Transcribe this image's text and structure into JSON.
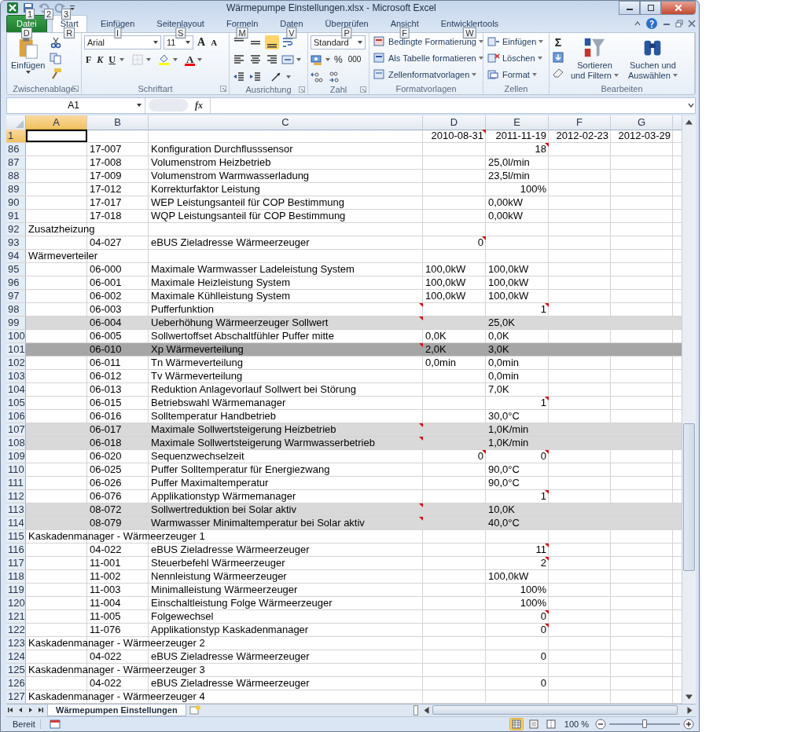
{
  "window": {
    "title": "Wärmepumpe Einstellungen.xlsx - Microsoft Excel"
  },
  "quick_access": {
    "keytips": [
      "1",
      "2",
      "3"
    ]
  },
  "tabs": [
    {
      "label": "Datei",
      "kind": "file",
      "selected": false,
      "keytip": "D"
    },
    {
      "label": "Start",
      "kind": "tab",
      "selected": true,
      "keytip": "R"
    },
    {
      "label": "Einfügen",
      "kind": "tab",
      "selected": false,
      "keytip": "I"
    },
    {
      "label": "Seitenlayout",
      "kind": "tab",
      "selected": false,
      "keytip": "S"
    },
    {
      "label": "Formeln",
      "kind": "tab",
      "selected": false,
      "keytip": "M"
    },
    {
      "label": "Daten",
      "kind": "tab",
      "selected": false,
      "keytip": "V"
    },
    {
      "label": "Überprüfen",
      "kind": "tab",
      "selected": false,
      "keytip": "P"
    },
    {
      "label": "Ansicht",
      "kind": "tab",
      "selected": false,
      "keytip": "F"
    },
    {
      "label": "Entwicklertools",
      "kind": "tab",
      "selected": false,
      "keytip": "W"
    }
  ],
  "ribbon": {
    "groups": [
      {
        "label": "Zwischenablage",
        "launcher": true,
        "paste": "Einfügen"
      },
      {
        "label": "Schriftart",
        "launcher": true,
        "font": "Arial",
        "size": "11",
        "grow": "A",
        "shrink": "A",
        "bold": "F",
        "italic": "K",
        "underline": "U",
        "color_letter": "A"
      },
      {
        "label": "Ausrichtung",
        "launcher": true,
        "vertical_align": [
          {
            "selected": false
          },
          {
            "selected": false
          },
          {
            "selected": true
          }
        ]
      },
      {
        "label": "Zahl",
        "launcher": true,
        "format": "Standard",
        "percent": "%",
        "thousands": "000"
      },
      {
        "label": "Formatvorlagen",
        "launcher": false,
        "items": [
          "Bedingte Formatierung",
          "Als Tabelle formatieren",
          "Zellenformatvorlagen"
        ]
      },
      {
        "label": "Zellen",
        "launcher": false,
        "items": [
          "Einfügen",
          "Löschen",
          "Format"
        ]
      },
      {
        "label": "Bearbeiten",
        "launcher": false,
        "sum": "Σ",
        "sort": [
          "Sortieren",
          "und Filtern"
        ],
        "find": [
          "Suchen und",
          "Auswählen"
        ]
      }
    ]
  },
  "formula_bar": {
    "name_box": "A1",
    "fx": "fx"
  },
  "sheet": {
    "columns": [
      {
        "label": "A",
        "selected": true
      },
      {
        "label": "B",
        "selected": false
      },
      {
        "label": "C",
        "selected": false
      },
      {
        "label": "D",
        "selected": false
      },
      {
        "label": "E",
        "selected": false
      },
      {
        "label": "F",
        "selected": false
      },
      {
        "label": "G",
        "selected": false
      }
    ],
    "rows": [
      {
        "num": "1",
        "selected": true,
        "kind": "normal",
        "d": {
          "text": "2010-08-31",
          "right": true,
          "note": true
        },
        "e": {
          "text": "2011-11-19",
          "right": true,
          "note": false
        },
        "f": {
          "text": "2012-02-23",
          "right": true,
          "note": false
        },
        "g": {
          "text": "2012-03-29",
          "right": true,
          "note": false
        }
      },
      {
        "num": "86",
        "selected": false,
        "kind": "normal",
        "b": "17-007",
        "c": {
          "text": "Konfiguration Durchflusssensor",
          "note": false
        },
        "e": {
          "text": "18",
          "right": true,
          "note": true
        }
      },
      {
        "num": "87",
        "selected": false,
        "kind": "normal",
        "b": "17-008",
        "c": {
          "text": "Volumenstrom Heizbetrieb",
          "note": false
        },
        "e": {
          "text": "25,0l/min",
          "right": false,
          "note": false
        }
      },
      {
        "num": "88",
        "selected": false,
        "kind": "normal",
        "b": "17-009",
        "c": {
          "text": "Volumenstrom Warmwasserladung",
          "note": false
        },
        "e": {
          "text": "23,5l/min",
          "right": false,
          "note": false
        }
      },
      {
        "num": "89",
        "selected": false,
        "kind": "normal",
        "b": "17-012",
        "c": {
          "text": "Korrekturfaktor Leistung",
          "note": false
        },
        "e": {
          "text": "100%",
          "right": true,
          "note": false
        }
      },
      {
        "num": "90",
        "selected": false,
        "kind": "normal",
        "b": "17-017",
        "c": {
          "text": "WEP Leistungsanteil für COP Bestimmung",
          "note": false
        },
        "e": {
          "text": "0,00kW",
          "right": false,
          "note": false
        }
      },
      {
        "num": "91",
        "selected": false,
        "kind": "normal",
        "b": "17-018",
        "c": {
          "text": "WQP Leistungsanteil für COP Bestimmung",
          "note": false
        },
        "e": {
          "text": "0,00kW",
          "right": false,
          "note": false
        }
      },
      {
        "num": "92",
        "selected": false,
        "kind": "normal",
        "a": "Zusatzheizung"
      },
      {
        "num": "93",
        "selected": false,
        "kind": "normal",
        "b": "04-027",
        "c": {
          "text": "eBUS Zieladresse Wärmeerzeuger",
          "note": false
        },
        "d": {
          "text": "0",
          "right": true,
          "note": true
        }
      },
      {
        "num": "94",
        "selected": false,
        "kind": "normal",
        "a": "Wärmeverteiler"
      },
      {
        "num": "95",
        "selected": false,
        "kind": "normal",
        "b": "06-000",
        "c": {
          "text": "Maximale Warmwasser Ladeleistung System",
          "note": false
        },
        "d": {
          "text": "100,0kW",
          "right": false,
          "note": false
        },
        "e": {
          "text": "100,0kW",
          "right": false,
          "note": false
        }
      },
      {
        "num": "96",
        "selected": false,
        "kind": "normal",
        "b": "06-001",
        "c": {
          "text": "Maximale Heizleistung System",
          "note": false
        },
        "d": {
          "text": "100,0kW",
          "right": false,
          "note": false
        },
        "e": {
          "text": "100,0kW",
          "right": false,
          "note": false
        }
      },
      {
        "num": "97",
        "selected": false,
        "kind": "normal",
        "b": "06-002",
        "c": {
          "text": "Maximale Kühlleistung System",
          "note": false
        },
        "d": {
          "text": "100,0kW",
          "right": false,
          "note": false
        },
        "e": {
          "text": "100,0kW",
          "right": false,
          "note": false
        }
      },
      {
        "num": "98",
        "selected": false,
        "kind": "normal",
        "b": "06-003",
        "c": {
          "text": "Pufferfunktion",
          "note": true
        },
        "e": {
          "text": "1",
          "right": true,
          "note": true
        }
      },
      {
        "num": "99",
        "selected": false,
        "kind": "highlight",
        "b": "06-004",
        "c": {
          "text": "Ueberhöhung Wärmeerzeuger Sollwert",
          "note": true
        },
        "e": {
          "text": "25,0K",
          "right": false,
          "note": false
        }
      },
      {
        "num": "100",
        "selected": false,
        "kind": "normal",
        "b": "06-005",
        "c": {
          "text": "Sollwertoffset Abschaltfühler Puffer mitte",
          "note": false
        },
        "d": {
          "text": "0,0K",
          "right": false,
          "note": false
        },
        "e": {
          "text": "0,0K",
          "right": false,
          "note": false
        }
      },
      {
        "num": "101",
        "selected": false,
        "kind": "strong",
        "b": "06-010",
        "c": {
          "text": "Xp Wärmeverteilung",
          "note": true
        },
        "d": {
          "text": "2,0K",
          "right": false,
          "note": false
        },
        "e": {
          "text": "3,0K",
          "right": false,
          "note": false
        }
      },
      {
        "num": "102",
        "selected": false,
        "kind": "normal",
        "b": "06-011",
        "c": {
          "text": "Tn Wärmeverteilung",
          "note": false
        },
        "d": {
          "text": "0,0min",
          "right": false,
          "note": false
        },
        "e": {
          "text": "0,0min",
          "right": false,
          "note": false
        }
      },
      {
        "num": "103",
        "selected": false,
        "kind": "normal",
        "b": "06-012",
        "c": {
          "text": "Tv Wärmeverteilung",
          "note": false
        },
        "e": {
          "text": "0,0min",
          "right": false,
          "note": false
        }
      },
      {
        "num": "104",
        "selected": false,
        "kind": "normal",
        "b": "06-013",
        "c": {
          "text": "Reduktion Anlagevorlauf Sollwert bei Störung",
          "note": false
        },
        "e": {
          "text": "7,0K",
          "right": false,
          "note": false
        }
      },
      {
        "num": "105",
        "selected": false,
        "kind": "normal",
        "b": "06-015",
        "c": {
          "text": "Betriebswahl Wärmemanager",
          "note": false
        },
        "e": {
          "text": "1",
          "right": true,
          "note": true
        }
      },
      {
        "num": "106",
        "selected": false,
        "kind": "normal",
        "b": "06-016",
        "c": {
          "text": "Solltemperatur Handbetrieb",
          "note": false
        },
        "e": {
          "text": "30,0°C",
          "right": false,
          "note": false
        }
      },
      {
        "num": "107",
        "selected": false,
        "kind": "highlight",
        "b": "06-017",
        "c": {
          "text": "Maximale Sollwertsteigerung Heizbetrieb",
          "note": true
        },
        "e": {
          "text": "1,0K/min",
          "right": false,
          "note": false
        }
      },
      {
        "num": "108",
        "selected": false,
        "kind": "highlight",
        "b": "06-018",
        "c": {
          "text": "Maximale Sollwertsteigerung Warmwasserbetrieb",
          "note": true
        },
        "e": {
          "text": "1,0K/min",
          "right": false,
          "note": false
        }
      },
      {
        "num": "109",
        "selected": false,
        "kind": "normal",
        "b": "06-020",
        "c": {
          "text": "Sequenzwechselzeit",
          "note": false
        },
        "d": {
          "text": "0",
          "right": true,
          "note": true
        },
        "e": {
          "text": "0",
          "right": true,
          "note": true
        }
      },
      {
        "num": "110",
        "selected": false,
        "kind": "normal",
        "b": "06-025",
        "c": {
          "text": "Puffer Solltemperatur für Energiezwang",
          "note": false
        },
        "e": {
          "text": "90,0°C",
          "right": false,
          "note": false
        }
      },
      {
        "num": "111",
        "selected": false,
        "kind": "normal",
        "b": "06-026",
        "c": {
          "text": "Puffer Maximaltemperatur",
          "note": false
        },
        "e": {
          "text": "90,0°C",
          "right": false,
          "note": false
        }
      },
      {
        "num": "112",
        "selected": false,
        "kind": "normal",
        "b": "06-076",
        "c": {
          "text": "Applikationstyp Wärmemanager",
          "note": false
        },
        "e": {
          "text": "1",
          "right": true,
          "note": true
        }
      },
      {
        "num": "113",
        "selected": false,
        "kind": "highlight",
        "b": "08-072",
        "c": {
          "text": "Sollwertreduktion bei Solar aktiv",
          "note": true
        },
        "e": {
          "text": "10,0K",
          "right": false,
          "note": false
        }
      },
      {
        "num": "114",
        "selected": false,
        "kind": "highlight",
        "b": "08-079",
        "c": {
          "text": "Warmwasser Minimaltemperatur bei Solar aktiv",
          "note": true
        },
        "e": {
          "text": "40,0°C",
          "right": false,
          "note": false
        }
      },
      {
        "num": "115",
        "selected": false,
        "kind": "normal",
        "a": "Kaskadenmanager - Wärmeerzeuger 1"
      },
      {
        "num": "116",
        "selected": false,
        "kind": "normal",
        "b": "04-022",
        "c": {
          "text": "eBUS  Zieladresse Wärmeerzeuger",
          "note": false
        },
        "e": {
          "text": "11",
          "right": true,
          "note": true
        }
      },
      {
        "num": "117",
        "selected": false,
        "kind": "normal",
        "b": "11-001",
        "c": {
          "text": "Steuerbefehl Wärmeerzeuger",
          "note": false
        },
        "e": {
          "text": "2",
          "right": true,
          "note": true
        }
      },
      {
        "num": "118",
        "selected": false,
        "kind": "normal",
        "b": "11-002",
        "c": {
          "text": "Nennleistung Wärmeerzeuger",
          "note": false
        },
        "e": {
          "text": "100,0kW",
          "right": false,
          "note": false
        }
      },
      {
        "num": "119",
        "selected": false,
        "kind": "normal",
        "b": "11-003",
        "c": {
          "text": "Minimalleistung Wärmeerzeuger",
          "note": false
        },
        "e": {
          "text": "100%",
          "right": true,
          "note": false
        }
      },
      {
        "num": "120",
        "selected": false,
        "kind": "normal",
        "b": "11-004",
        "c": {
          "text": "Einschaltleistung Folge Wärmeerzeuger",
          "note": false
        },
        "e": {
          "text": "100%",
          "right": true,
          "note": false
        }
      },
      {
        "num": "121",
        "selected": false,
        "kind": "normal",
        "b": "11-005",
        "c": {
          "text": "Folgewechsel",
          "note": false
        },
        "e": {
          "text": "0",
          "right": true,
          "note": true
        }
      },
      {
        "num": "122",
        "selected": false,
        "kind": "normal",
        "b": "11-076",
        "c": {
          "text": "Applikationstyp Kaskadenmanager",
          "note": false
        },
        "e": {
          "text": "0",
          "right": true,
          "note": true
        }
      },
      {
        "num": "123",
        "selected": false,
        "kind": "normal",
        "a": "Kaskadenmanager - Wärmeerzeuger 2"
      },
      {
        "num": "124",
        "selected": false,
        "kind": "normal",
        "b": "04-022",
        "c": {
          "text": "eBUS Zieladresse Wärmeerzeuger",
          "note": false
        },
        "e": {
          "text": "0",
          "right": true,
          "note": false
        }
      },
      {
        "num": "125",
        "selected": false,
        "kind": "normal",
        "a": "Kaskadenmanager - Wärmeerzeuger 3"
      },
      {
        "num": "126",
        "selected": false,
        "kind": "normal",
        "b": "04-022",
        "c": {
          "text": "eBUS Zieladresse Wärmeerzeuger",
          "note": false
        },
        "e": {
          "text": "0",
          "right": true,
          "note": false
        }
      },
      {
        "num": "127",
        "selected": false,
        "kind": "normal",
        "a": "Kaskadenmanager - Wärmeerzeuger 4"
      }
    ]
  },
  "sheet_tabs": [
    {
      "label": "Wärmepumpen Einstellungen",
      "selected": true
    }
  ],
  "status_bar": {
    "text": "Bereit",
    "views": [
      {
        "selected": true
      },
      {
        "selected": false
      },
      {
        "selected": false
      }
    ],
    "zoom": "100 %",
    "level": 0.5
  }
}
